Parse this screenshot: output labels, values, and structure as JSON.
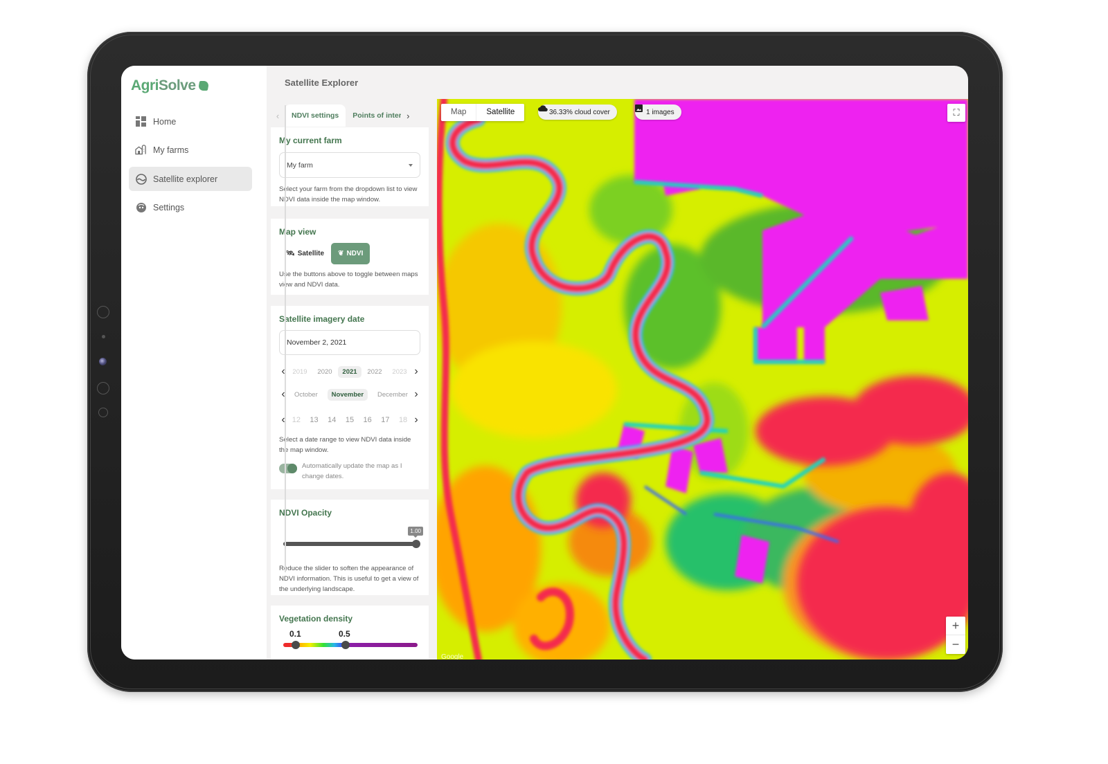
{
  "app": {
    "brand_part1": "Agri",
    "brand_part2": "Solve",
    "page_title": "Satellite Explorer"
  },
  "sidebar": {
    "items": [
      {
        "label": "Home",
        "icon": "dashboard-grid-icon",
        "active": false
      },
      {
        "label": "My farms",
        "icon": "farm-barn-icon",
        "active": false
      },
      {
        "label": "Satellite explorer",
        "icon": "satellite-orbit-icon",
        "active": true
      },
      {
        "label": "Settings",
        "icon": "user-face-icon",
        "active": false
      }
    ]
  },
  "panel": {
    "tabs": [
      {
        "label": "NDVI settings",
        "active": true
      },
      {
        "label": "Points of interest",
        "active": false
      }
    ],
    "farm": {
      "title": "My current farm",
      "selected": "My farm",
      "help": "Select your farm from the dropdown list to view NDVI data inside the map window."
    },
    "map_view": {
      "title": "Map view",
      "buttons": [
        {
          "label": "Satellite",
          "icon": "satellite-icon",
          "active": false
        },
        {
          "label": "NDVI",
          "icon": "plant-icon",
          "active": true
        }
      ],
      "help": "Use the buttons above to toggle between maps view and NDVI data."
    },
    "imagery_date": {
      "title": "Satellite imagery date",
      "value": "November 2, 2021",
      "years": [
        "2019",
        "2020",
        "2021",
        "2022",
        "2023"
      ],
      "selected_year": "2021",
      "months": [
        "October",
        "November",
        "December"
      ],
      "selected_month": "November",
      "days": [
        "12",
        "13",
        "14",
        "15",
        "16",
        "17",
        "18"
      ],
      "help": "Select a date range to view NDVI data inside the map window.",
      "auto_update_label": "Automatically update the map as I change dates.",
      "auto_update": true
    },
    "opacity": {
      "title": "NDVI Opacity",
      "value": "1.00",
      "fraction": 1.0,
      "help": "Reduce the slider to soften the appearance of NDVI information. This is useful to get a view of the underlying landscape."
    },
    "vegetation": {
      "title": "Vegetation density",
      "low": "0.1",
      "high": "0.5",
      "low_value": 0.1,
      "high_value": 0.5
    }
  },
  "map": {
    "type_buttons": [
      {
        "label": "Map",
        "active": false
      },
      {
        "label": "Satellite",
        "active": true
      }
    ],
    "cloud_cover": "36.33% cloud cover",
    "images": "1 images",
    "zoom_in": "+",
    "zoom_out": "−",
    "attribution": "Google",
    "colors": {
      "magenta": "#ee22f0",
      "red": "#f42b4e",
      "yellow": "#e9f200",
      "green": "#6fcf1a",
      "cyan": "#1fd3c0",
      "blue": "#3a6bf0"
    }
  },
  "theme": {
    "accent": "#6c9b7b",
    "brand_green": "#5aa874",
    "heading_green": "#44764f"
  }
}
